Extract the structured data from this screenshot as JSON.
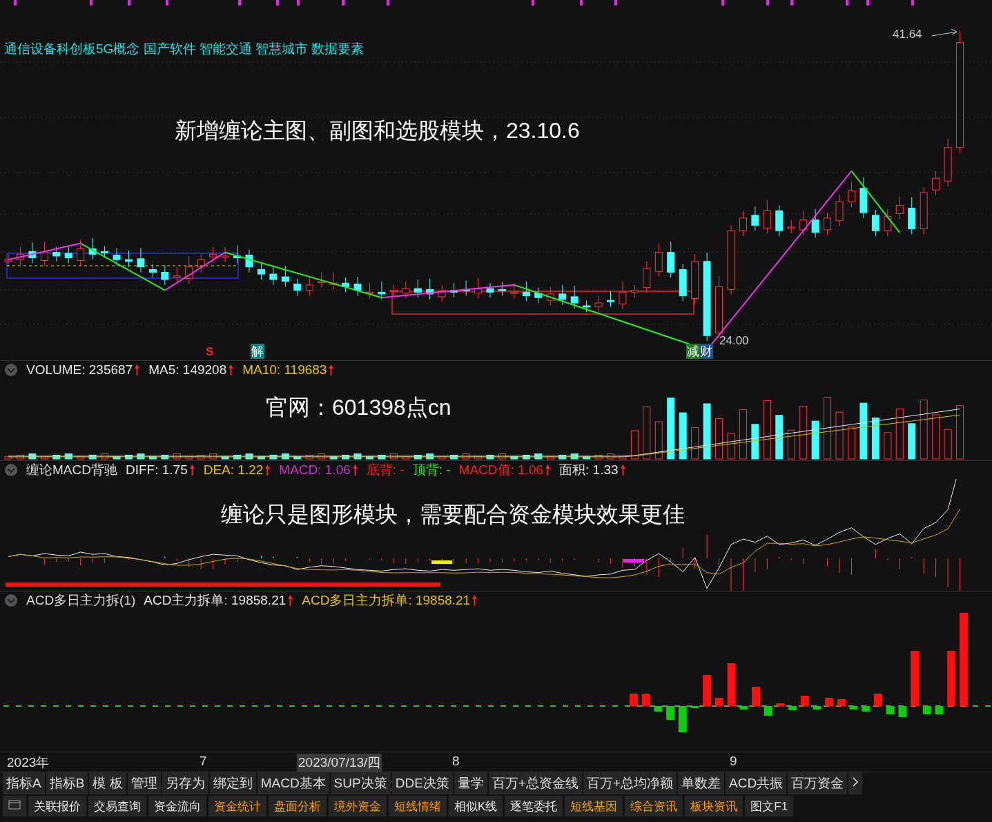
{
  "main_chart": {
    "concepts": "通信设备科创板5G概念 国产软件 智能交通 智慧城市 数据要素",
    "caption": "新增缠论主图、副图和选股模块，23.10.6",
    "high_label": "41.64",
    "low_label": "24.00",
    "signals": [
      {
        "text": "S",
        "kind": "arrow"
      },
      {
        "text": "解",
        "kind": "badge",
        "color": "#138080"
      },
      {
        "text": "减",
        "kind": "badge",
        "color": "#1e7a1e"
      },
      {
        "text": "财",
        "kind": "badge",
        "color": "#1c4f8c"
      }
    ]
  },
  "panels": [
    {
      "kind": "volume",
      "caption": "官网：601398点cn",
      "items": [
        {
          "text": "VOLUME: 235687",
          "color": "#e6e6e6",
          "arrow": true
        },
        {
          "text": "MA5: 149208",
          "color": "#e6e6e6",
          "arrow": true
        },
        {
          "text": "MA10: 119683",
          "color": "#e6c300",
          "arrow": true
        }
      ]
    },
    {
      "kind": "macd",
      "title": "缠论MACD背驰",
      "caption": "缠论只是图形模块，需要配合资金模块效果更佳",
      "items": [
        {
          "text": "DIFF: 1.75",
          "color": "#e6e6e6",
          "arrow": true
        },
        {
          "text": "DEA: 1.22",
          "color": "#e6c300",
          "arrow": true
        },
        {
          "text": "MACD: 1.06",
          "color": "#cc33cc",
          "arrow": true
        },
        {
          "text": "底背: -",
          "color": "#ff2020",
          "arrow": false
        },
        {
          "text": "顶背: -",
          "color": "#22ee22",
          "arrow": false
        },
        {
          "text": "MACD值: 1.06",
          "color": "#ff2020",
          "arrow": true
        },
        {
          "text": "面积: 1.33",
          "color": "#e6e6e6",
          "arrow": true
        }
      ]
    },
    {
      "kind": "acd",
      "title": "ACD多日主力拆(1)",
      "items": [
        {
          "text": "ACD主力拆单: 19858.21",
          "color": "#e6e6e6",
          "arrow": true
        },
        {
          "text": "ACD多日主力拆单: 19858.21",
          "color": "#e6c300",
          "arrow": true
        }
      ]
    }
  ],
  "date_axis": [
    {
      "text": "2023年",
      "highlighted": false
    },
    {
      "text": "7",
      "highlighted": false
    },
    {
      "text": "2023/07/13/四",
      "highlighted": true
    },
    {
      "text": "8",
      "highlighted": false
    },
    {
      "text": "9",
      "highlighted": false
    }
  ],
  "indicator_tabs": [
    "指标A",
    "指标B",
    "模 板",
    "管理",
    "另存为",
    "绑定到",
    "MACD基本",
    "SUP决策",
    "DDE决策",
    "量学",
    "百万+总资金线",
    "百万+总均净额",
    "单数差",
    "ACD共振",
    "百万资金"
  ],
  "bottom_tabs": [
    {
      "label": "关联报价",
      "color": "#e6e6e6"
    },
    {
      "label": "交易查询",
      "color": "#e6e6e6"
    },
    {
      "label": "资金流向",
      "color": "#e6e6e6"
    },
    {
      "label": "资金统计",
      "color": "#ff9900"
    },
    {
      "label": "盘面分析",
      "color": "#ff9900"
    },
    {
      "label": "境外资金",
      "color": "#ff9900"
    },
    {
      "label": "短线情绪",
      "color": "#ff9900"
    },
    {
      "label": "相似K线",
      "color": "#e6e6e6"
    },
    {
      "label": "逐笔委托",
      "color": "#e6e6e6"
    },
    {
      "label": "短线基因",
      "color": "#ff9900"
    },
    {
      "label": "综合资讯",
      "color": "#ff9900"
    },
    {
      "label": "板块资讯",
      "color": "#ff9900"
    }
  ],
  "bottom_end_label": "图文F1"
}
